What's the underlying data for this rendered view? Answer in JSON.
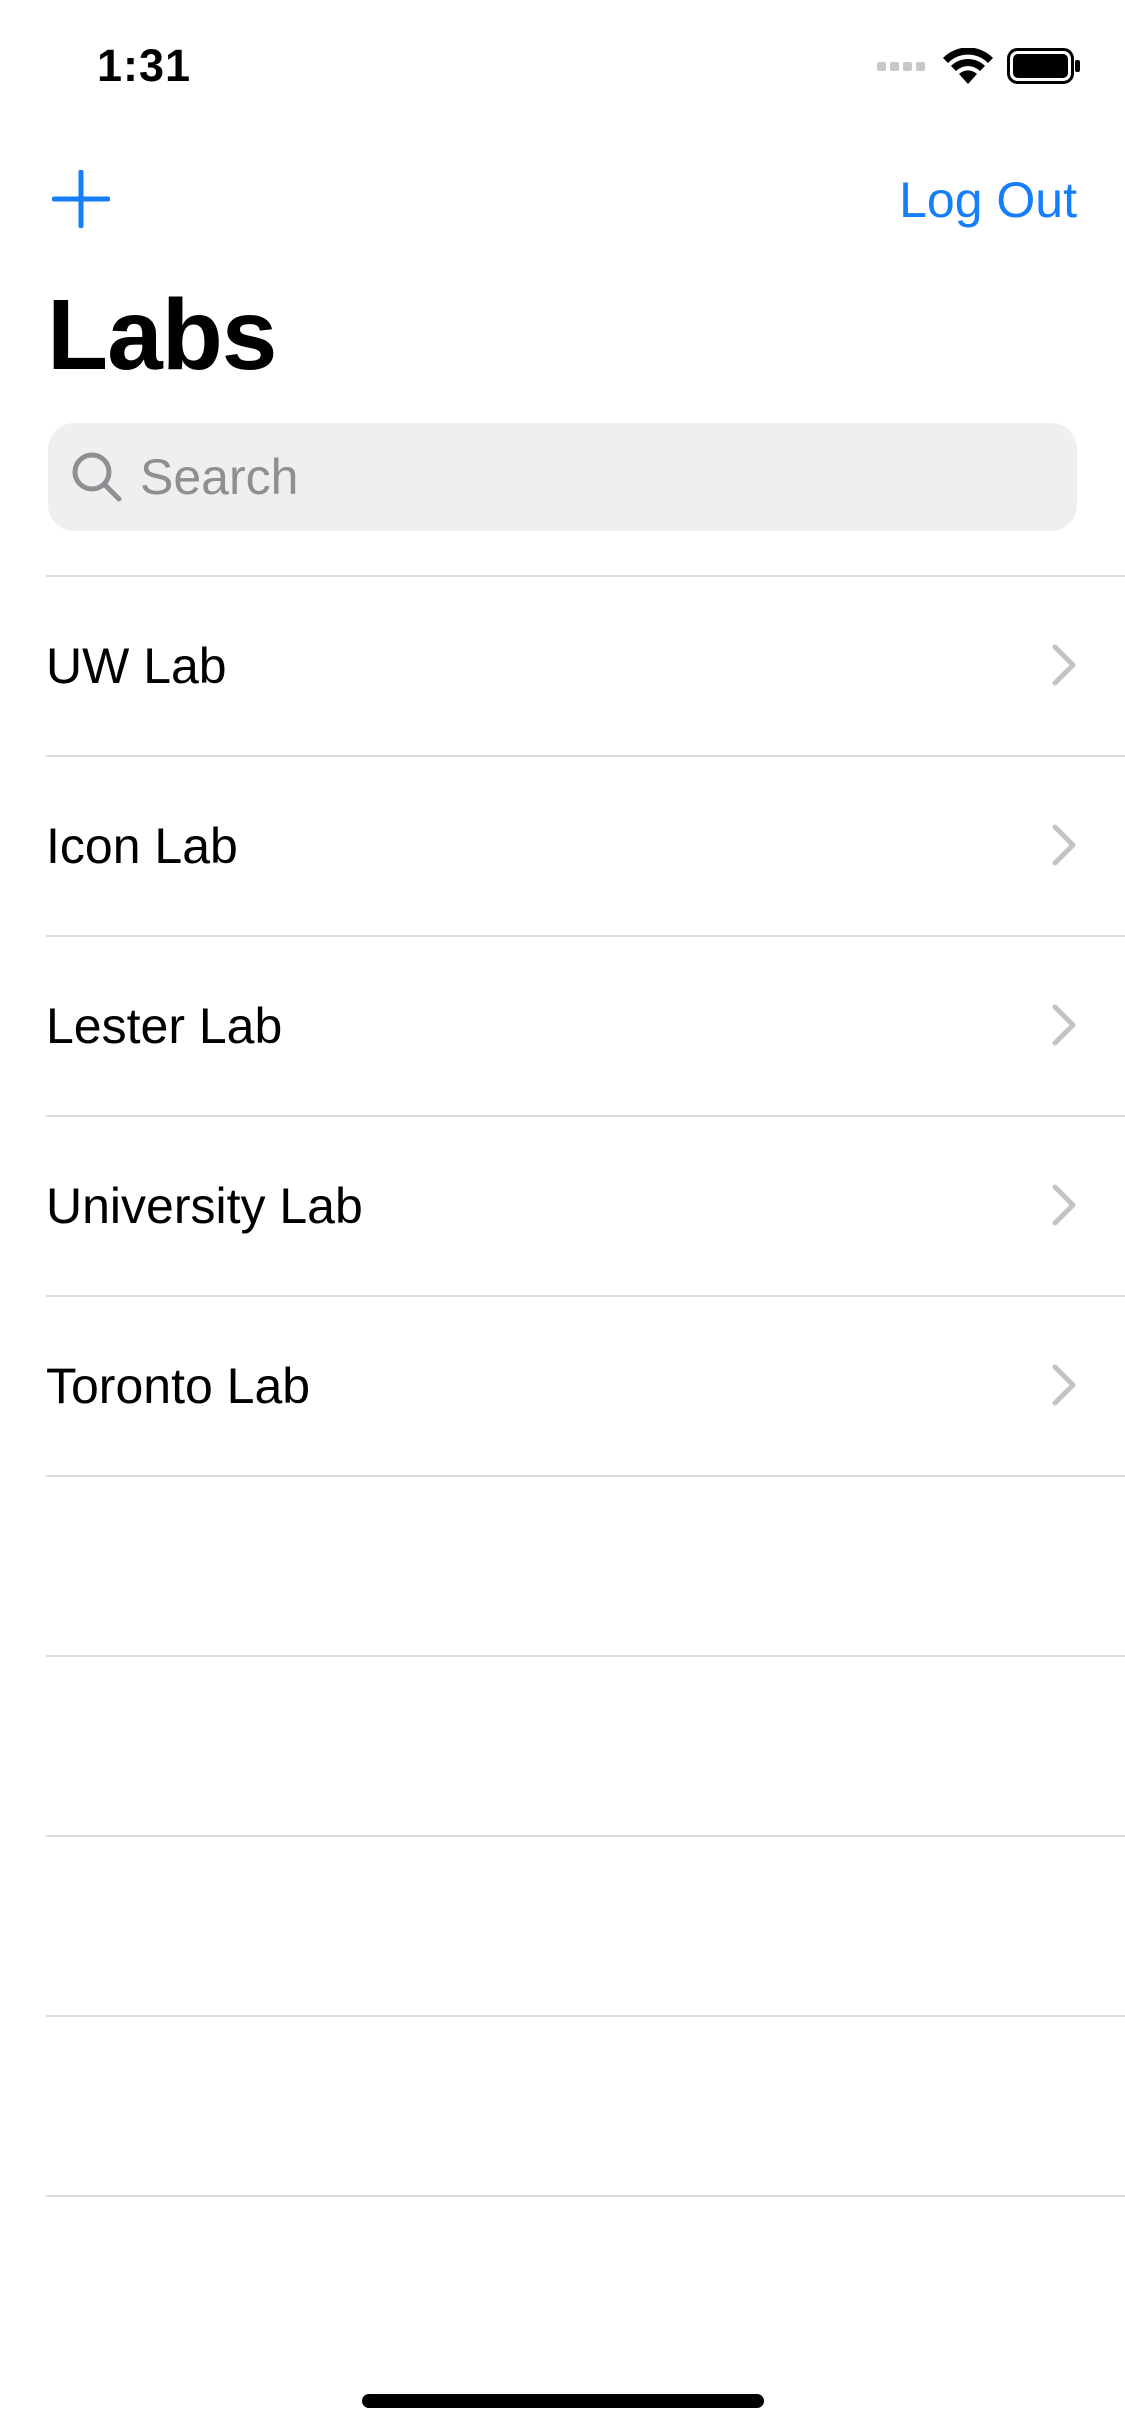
{
  "status_bar": {
    "time": "1:31",
    "icons": [
      "cellular-signal-icon",
      "wifi-icon",
      "battery-icon"
    ]
  },
  "nav": {
    "add_icon": "plus-icon",
    "logout_label": "Log Out",
    "accent_color": "#147efb"
  },
  "page": {
    "title": "Labs"
  },
  "search": {
    "placeholder": "Search",
    "value": ""
  },
  "labs": [
    {
      "label": "UW Lab"
    },
    {
      "label": "Icon Lab"
    },
    {
      "label": "Lester Lab"
    },
    {
      "label": "University Lab"
    },
    {
      "label": "Toronto Lab"
    }
  ],
  "empty_rows": 5
}
